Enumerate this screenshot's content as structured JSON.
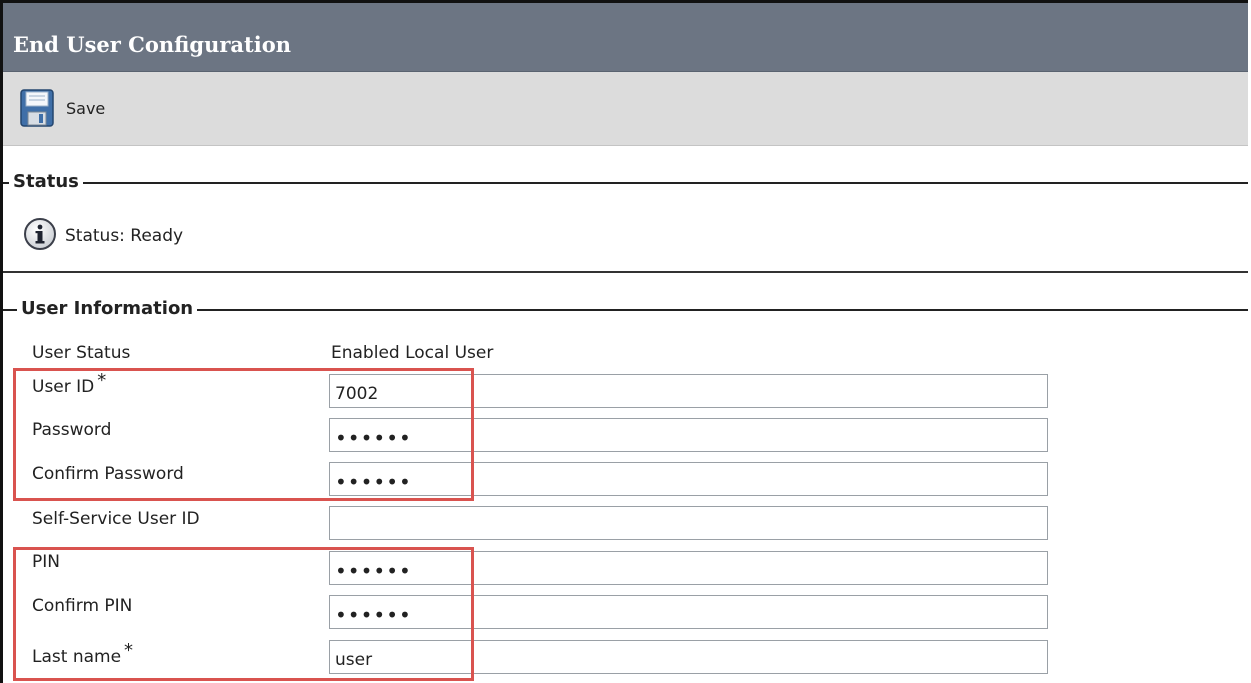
{
  "page": {
    "title": "End User Configuration"
  },
  "toolbar": {
    "save_label": "Save",
    "save_icon": "floppy-disk-icon"
  },
  "status_section": {
    "legend": "Status",
    "icon": "info-icon",
    "text": "Status: Ready"
  },
  "user_info": {
    "legend": "User Information",
    "user_status": {
      "label": "User Status",
      "value": "Enabled Local User"
    },
    "user_id": {
      "label": "User ID",
      "required": "*",
      "value": "7002"
    },
    "password": {
      "label": "Password",
      "value": "••••••"
    },
    "confirm_password": {
      "label": "Confirm Password",
      "value": "••••••"
    },
    "self_service_user_id": {
      "label": "Self-Service User ID",
      "value": ""
    },
    "pin": {
      "label": "PIN",
      "value": "••••••"
    },
    "confirm_pin": {
      "label": "Confirm PIN",
      "value": "••••••"
    },
    "last_name": {
      "label": "Last name",
      "required": "*",
      "value": "user"
    }
  },
  "colors": {
    "title_bar": "#6c7583",
    "toolbar": "#dcdcdc",
    "highlight_box": "#d9534f"
  }
}
